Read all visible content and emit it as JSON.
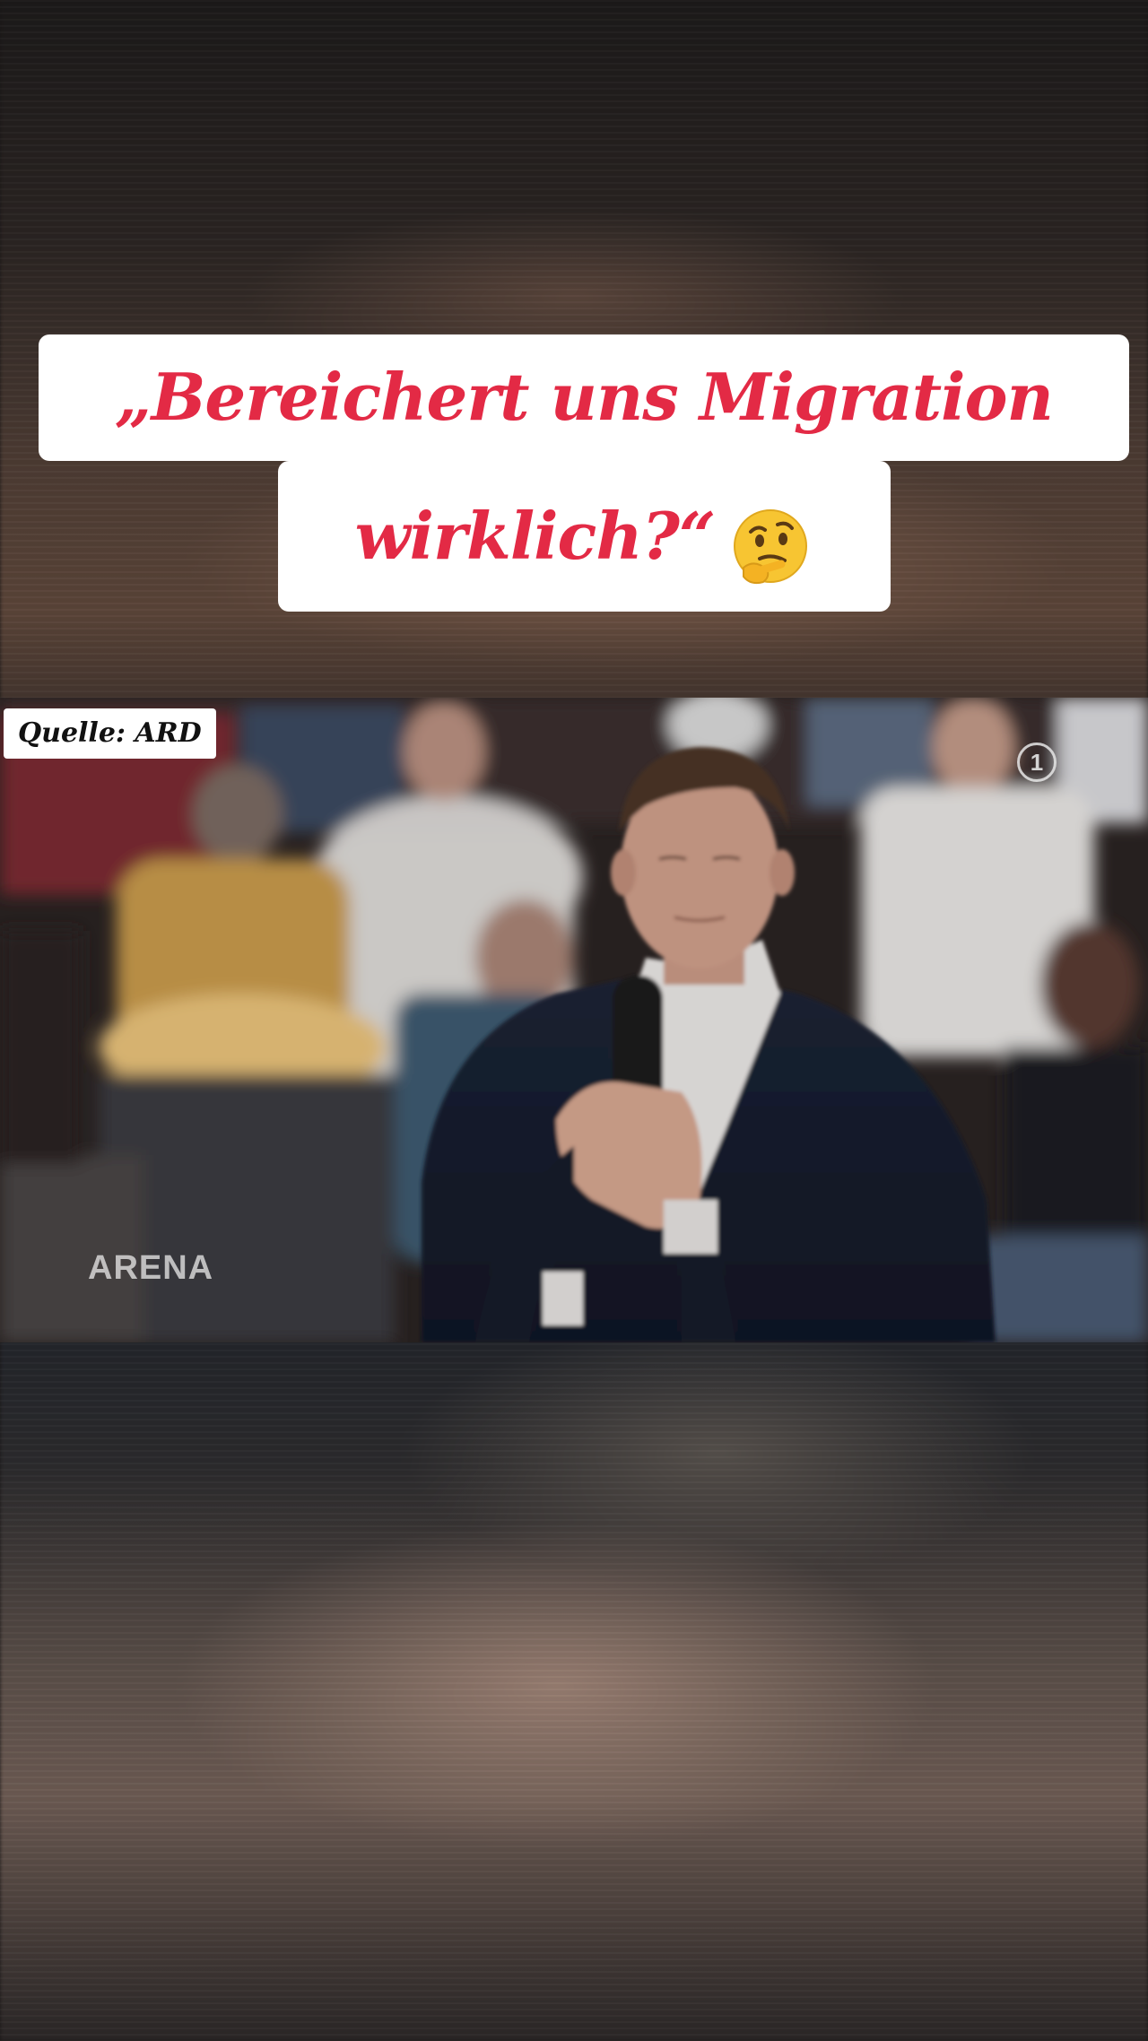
{
  "headline": {
    "line1": "„Bereichert uns Migration",
    "line2": "wirklich?“",
    "emoji": "thinking-face-emoji"
  },
  "video": {
    "source_label": "Quelle: ARD",
    "show_logo": "ARENA",
    "channel_logo": "1"
  },
  "colors": {
    "headline_text": "#e32a45",
    "headline_bg": "#ffffff"
  }
}
